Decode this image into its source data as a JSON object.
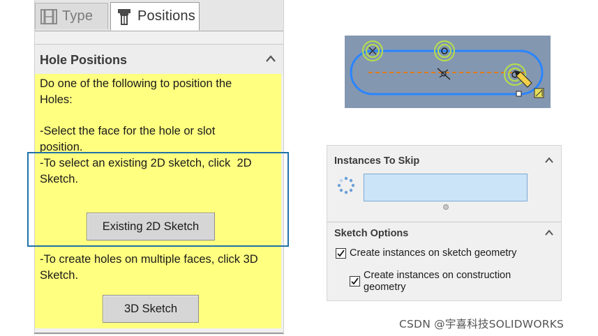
{
  "tabs": [
    {
      "label": "Type",
      "icon": "type-icon"
    },
    {
      "label": "Positions",
      "icon": "positions-icon"
    }
  ],
  "hole_positions": {
    "title": "Hole Positions",
    "instructions": [
      "Do one of the following to position the\nHoles:",
      "-Select the face for the hole or slot\nposition.",
      "-To select an existing 2D sketch, click  2D\nSketch.",
      "-To create holes on multiple faces, click 3D\nSketch."
    ],
    "existing_2d_sketch_button": "Existing 2D Sketch",
    "sketch_3d_button": "3D Sketch"
  },
  "instances_to_skip": {
    "title": "Instances To Skip",
    "icon": "instances-pattern-icon"
  },
  "sketch_options": {
    "title": "Sketch Options",
    "create_on_sketch_geometry": {
      "label": "Create instances on sketch geometry",
      "checked": true
    },
    "create_on_construction_geometry": {
      "label": "Create instances on construction\ngeometry",
      "checked": true
    }
  },
  "watermark": "CSDN @宇喜科技SOLIDWORKS",
  "colors": {
    "instruction_bg": "#ffff80",
    "highlight_border": "#1f72a8",
    "preview_bg": "#8497b0",
    "slot_outline": "#2a85ff",
    "centerline": "#e07a1a",
    "point_ring": "#b6e04a"
  }
}
